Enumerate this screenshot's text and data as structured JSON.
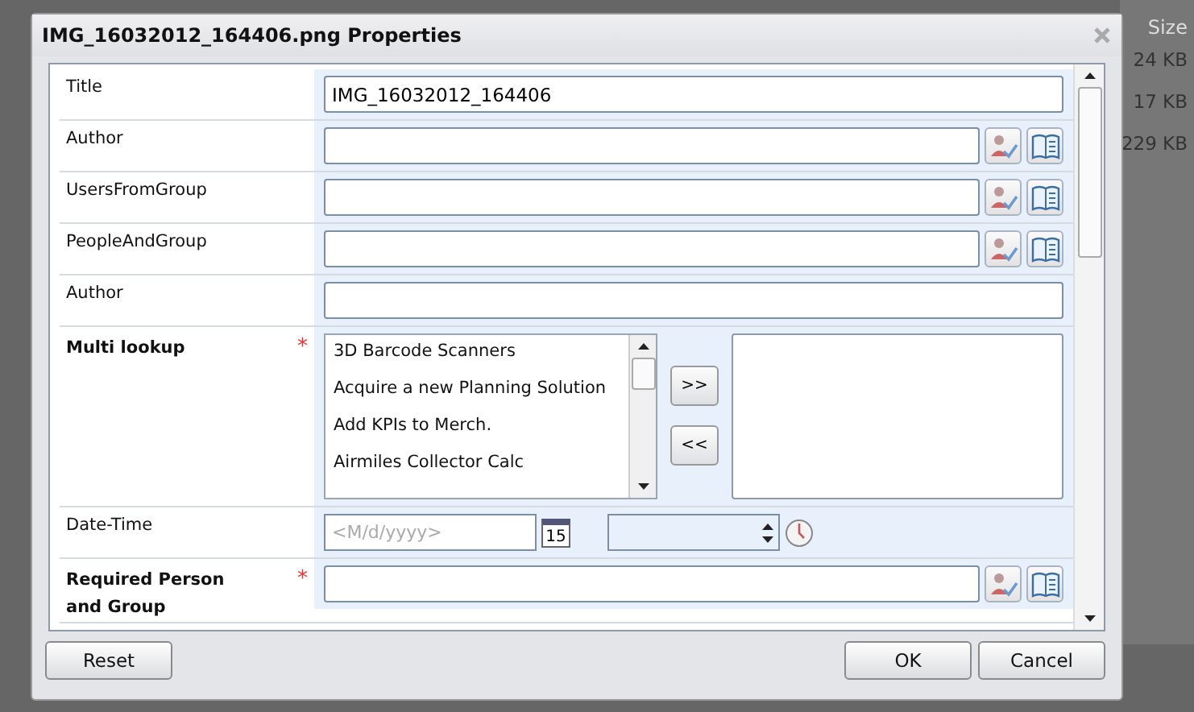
{
  "background": {
    "column_header": "Size",
    "sizes": [
      "24 KB",
      "17 KB",
      "229 KB"
    ]
  },
  "window": {
    "title": "IMG_16032012_164406.png Properties"
  },
  "fields": [
    {
      "label": "Title",
      "required": false,
      "kind": "text",
      "value": "IMG_16032012_164406"
    },
    {
      "label": "Author",
      "required": false,
      "kind": "people"
    },
    {
      "label": "UsersFromGroup",
      "required": false,
      "kind": "people"
    },
    {
      "label": "PeopleAndGroup",
      "required": false,
      "kind": "people"
    },
    {
      "label": "Author",
      "required": false,
      "kind": "text"
    },
    {
      "label": "Multi lookup",
      "required": true,
      "kind": "multi",
      "options": [
        "3D Barcode Scanners",
        "Acquire a new Planning Solution",
        "Add KPIs to Merch.",
        "Airmiles Collector Calc"
      ],
      "add": ">>",
      "remove": "<<"
    },
    {
      "label": "Date-Time",
      "required": false,
      "kind": "datetime",
      "placeholder": "<M/d/yyyy>",
      "calendar_day": "15"
    },
    {
      "label": "Required Person and Group",
      "required": true,
      "kind": "people"
    }
  ],
  "required_mark": "*",
  "buttons": {
    "reset": "Reset",
    "ok": "OK",
    "cancel": "Cancel"
  }
}
